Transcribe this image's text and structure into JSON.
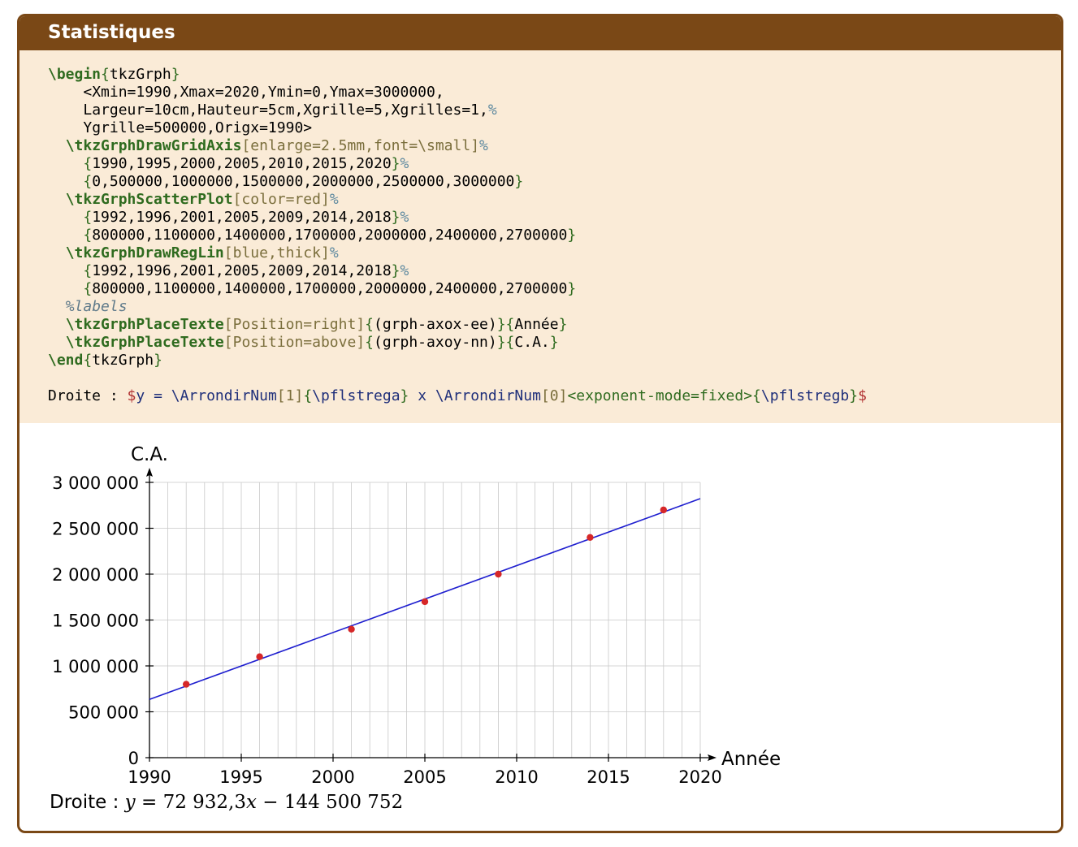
{
  "box": {
    "title": "Statistiques"
  },
  "code": {
    "line1_cmd": "\\begin",
    "line1_arg": "tkzGrph",
    "line2": "<Xmin=1990,Xmax=2020,Ymin=0,Ymax=3000000,",
    "line3": "Largeur=10cm,Hauteur=5cm,Xgrille=5,Xgrilles=1,",
    "line4": "Ygrille=500000,Origx=1990>",
    "line5_cmd": "\\tkzGrphDrawGridAxis",
    "line5_opt": "[enlarge=2.5mm,font=\\small]",
    "line6": "1990,1995,2000,2005,2010,2015,2020",
    "line7": "0,500000,1000000,1500000,2000000,2500000,3000000",
    "line8_cmd": "\\tkzGrphScatterPlot",
    "line8_opt": "[color=red]",
    "line9": "1992,1996,2001,2005,2009,2014,2018",
    "line10": "800000,1100000,1400000,1700000,2000000,2400000,2700000",
    "line11_cmd": "\\tkzGrphDrawRegLin",
    "line11_opt": "[blue,thick]",
    "line12": "1992,1996,2001,2005,2009,2014,2018",
    "line13": "800000,1100000,1400000,1700000,2000000,2400000,2700000",
    "line14_comment": "%labels",
    "line15_cmd": "\\tkzGrphPlaceTexte",
    "line15_opt": "[Position=right]",
    "line15_arg1": "(grph-axox-ee)",
    "line15_arg2": "Année",
    "line16_cmd": "\\tkzGrphPlaceTexte",
    "line16_opt": "[Position=above]",
    "line16_arg1": "(grph-axoy-nn)",
    "line16_arg2": "C.A.",
    "line17_cmd": "\\end",
    "line17_arg": "tkzGrph",
    "droite_label": "Droite : ",
    "droite_y": "y = ",
    "droite_cmd1": "\\ArrondirNum",
    "droite_opt1": "[1]",
    "droite_arg1": "\\pflstrega",
    "droite_x": " x ",
    "droite_cmd2": "\\ArrondirNum",
    "droite_opt2": "[0]",
    "droite_opt3": "<exponent-mode=fixed>",
    "droite_arg2": "\\pflstregb"
  },
  "result": {
    "label": "Droite : ",
    "equation_lhs": "y",
    "equation_eq": " = 72 932,3",
    "equation_x": "x",
    "equation_rest": " − 144 500 752"
  },
  "chart_data": {
    "type": "scatter",
    "xlabel": "Année",
    "ylabel": "C.A.",
    "xlim": [
      1990,
      2020
    ],
    "ylim": [
      0,
      3000000
    ],
    "x_ticks": [
      1990,
      1995,
      2000,
      2005,
      2010,
      2015,
      2020
    ],
    "y_ticks": [
      0,
      500000,
      1000000,
      1500000,
      2000000,
      2500000,
      3000000
    ],
    "x_tick_labels": [
      "1990",
      "1995",
      "2000",
      "2005",
      "2010",
      "2015",
      "2020"
    ],
    "y_tick_labels": [
      "0",
      "500 000",
      "1 000 000",
      "1 500 000",
      "2 000 000",
      "2 500 000",
      "3 000 000"
    ],
    "x_minor_step": 1,
    "y_major_step": 500000,
    "grid": true,
    "series": [
      {
        "x": [
          1992,
          1996,
          2001,
          2005,
          2009,
          2014,
          2018
        ],
        "y": [
          800000,
          1100000,
          1400000,
          1700000,
          2000000,
          2400000,
          2700000
        ],
        "color": "#d62728"
      }
    ],
    "regression_line": {
      "slope": 72932.3,
      "intercept": -144500752,
      "color": "#1f1fcf"
    },
    "colors": {
      "grid": "#c8c8c8",
      "axis": "#000000"
    }
  }
}
